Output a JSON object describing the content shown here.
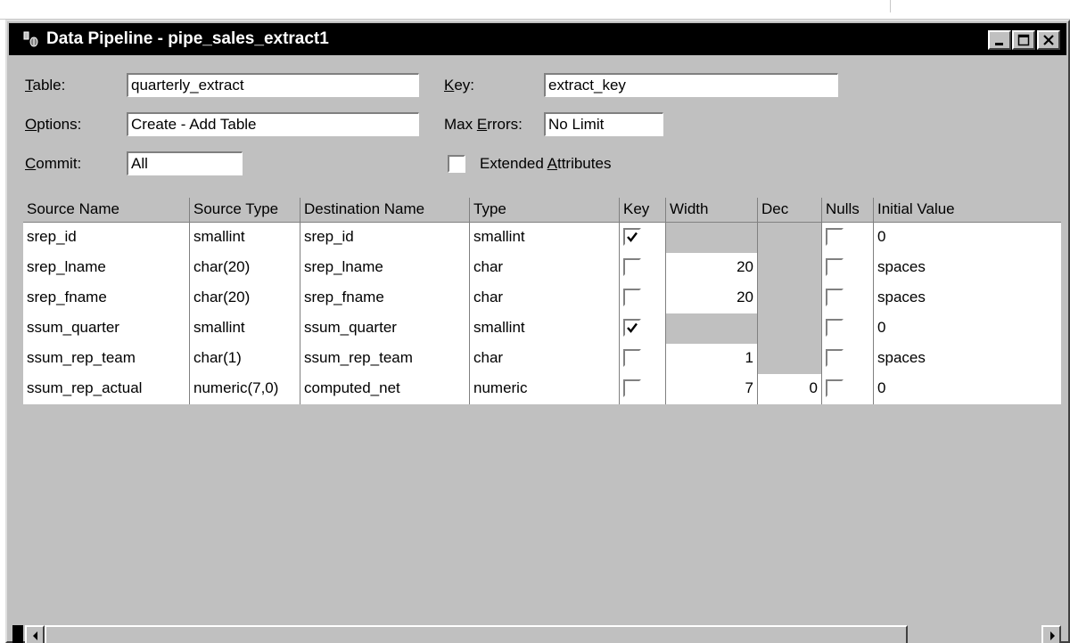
{
  "window": {
    "title": "Data Pipeline - pipe_sales_extract1",
    "controls": [
      "minimize",
      "maximize",
      "close"
    ]
  },
  "form": {
    "table_label_pre": "",
    "table_label_u": "T",
    "table_label_post": "able:",
    "table_value": "quarterly_extract",
    "key_label_u": "K",
    "key_label_post": "ey:",
    "key_value": "extract_key",
    "options_label_u": "O",
    "options_label_post": "ptions:",
    "options_value": "Create - Add Table",
    "maxerrors_label_pre": "Max ",
    "maxerrors_label_u": "E",
    "maxerrors_label_post": "rrors:",
    "maxerrors_value": "No Limit",
    "commit_label_u": "C",
    "commit_label_post": "ommit:",
    "commit_value": "All",
    "extended_label_pre": "Extended ",
    "extended_label_u": "A",
    "extended_label_post": "ttributes",
    "extended_checked": false
  },
  "grid": {
    "columns": [
      "Source Name",
      "Source Type",
      "Destination Name",
      "Type",
      "Key",
      "Width",
      "Dec",
      "Nulls",
      "Initial Value"
    ],
    "rows": [
      {
        "source_name": "srep_id",
        "source_type": "smallint",
        "dest_name": "srep_id",
        "type": "smallint",
        "key": true,
        "width": "",
        "dec": "",
        "nulls": false,
        "initial": "0"
      },
      {
        "source_name": "srep_lname",
        "source_type": "char(20)",
        "dest_name": "srep_lname",
        "type": "char",
        "key": false,
        "width": "20",
        "dec": "",
        "nulls": false,
        "initial": "spaces"
      },
      {
        "source_name": "srep_fname",
        "source_type": "char(20)",
        "dest_name": "srep_fname",
        "type": "char",
        "key": false,
        "width": "20",
        "dec": "",
        "nulls": false,
        "initial": "spaces"
      },
      {
        "source_name": "ssum_quarter",
        "source_type": "smallint",
        "dest_name": "ssum_quarter",
        "type": "smallint",
        "key": true,
        "width": "",
        "dec": "",
        "nulls": false,
        "initial": "0"
      },
      {
        "source_name": "ssum_rep_team",
        "source_type": "char(1)",
        "dest_name": "ssum_rep_team",
        "type": "char",
        "key": false,
        "width": "1",
        "dec": "",
        "nulls": false,
        "initial": "spaces"
      },
      {
        "source_name": "ssum_rep_actual",
        "source_type": "numeric(7,0)",
        "dest_name": "computed_net",
        "type": "numeric",
        "key": false,
        "width": "7",
        "dec": "0",
        "nulls": false,
        "initial": "0"
      }
    ]
  },
  "icons": {
    "app": "pipeline-app-icon",
    "minimize": "minimize-icon",
    "maximize": "maximize-icon",
    "close": "close-icon",
    "scroll_left": "arrow-left-icon",
    "scroll_right": "arrow-right-icon",
    "check": "checkmark-icon"
  },
  "colors": {
    "titlebar": "#000000",
    "face": "#c0c0c0",
    "field": "#ffffff"
  }
}
